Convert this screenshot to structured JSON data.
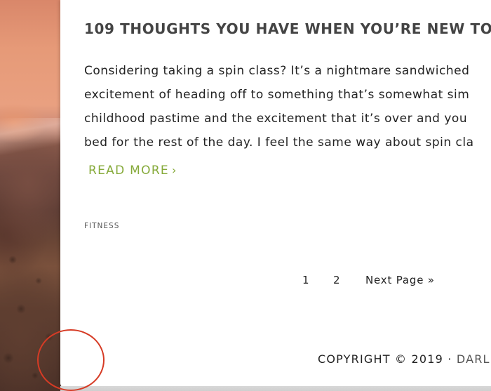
{
  "post": {
    "title": "109 THOUGHTS YOU HAVE WHEN YOU’RE NEW TO",
    "excerpt_lines": [
      "Considering taking a spin class? It’s a nightmare sandwiched",
      "excitement of heading off to something that’s somewhat sim",
      "childhood pastime and the excitement that it’s over and you",
      "bed for the rest of the day. I feel the same way about spin cla"
    ],
    "read_more_label": "READ MORE",
    "read_more_chevron": "›",
    "category": "FITNESS"
  },
  "pagination": {
    "pages": [
      "1",
      "2"
    ],
    "next_label": "Next Page »"
  },
  "footer": {
    "copyright": "COPYRIGHT © 2019 · ",
    "brand": "DARL"
  },
  "colors": {
    "accent_green": "#86aa3a",
    "annotation_red": "#d63b25",
    "title_gray": "#444444"
  }
}
